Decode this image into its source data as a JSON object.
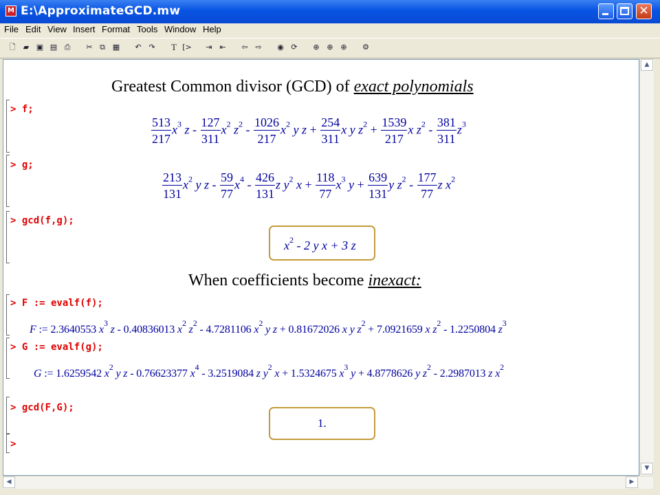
{
  "window": {
    "title": "E:\\ApproximateGCD.mw",
    "icon_name": "maple-icon",
    "buttons": [
      "minimize",
      "maximize",
      "close"
    ]
  },
  "menu": [
    "File",
    "Edit",
    "View",
    "Insert",
    "Format",
    "Tools",
    "Window",
    "Help"
  ],
  "toolbar_icons": [
    "new-icon",
    "open-icon",
    "save-icon",
    "save-all-icon",
    "print-icon",
    "cut-icon",
    "copy-icon",
    "paste-icon",
    "undo-icon",
    "redo-icon",
    "text-icon",
    "prompt-icon",
    "indent-icon",
    "outdent-icon",
    "back-icon",
    "forward-icon",
    "stop-icon",
    "restart-icon",
    "zoom-100-icon",
    "zoom-150-icon",
    "zoom-200-icon",
    "help-icon"
  ],
  "document": {
    "heading1": {
      "prefix": "Greatest Common divisor (GCD) of ",
      "emph": "exact polynomials"
    },
    "cmd_f": "> f;",
    "cmd_g": "> g;",
    "cmd_gcd": "> gcd(f,g);",
    "gcd_result": {
      "t1": "x",
      "e1": "2",
      "rest": " - 2 y x + 3 z"
    },
    "heading2": {
      "prefix": "When coefficients become ",
      "emph": "inexact:"
    },
    "cmd_F": "> F := evalf(f);",
    "cmd_G": "> G := evalf(g);",
    "cmd_gcdF": "> gcd(F,G);",
    "gcdF_result": "1.",
    "final_prompt": ">",
    "f_terms": [
      {
        "n": "513",
        "d": "217",
        "vars": "x^3 z",
        "sign": " - "
      },
      {
        "n": "127",
        "d": "311",
        "vars": "x^2 z^2",
        "sign": " - "
      },
      {
        "n": "1026",
        "d": "217",
        "vars": "x^2 y z",
        "sign": " + "
      },
      {
        "n": "254",
        "d": "311",
        "vars": "x y z^2",
        "sign": " + "
      },
      {
        "n": "1539",
        "d": "217",
        "vars": "x z^2",
        "sign": " - "
      },
      {
        "n": "381",
        "d": "311",
        "vars": "z^3",
        "sign": ""
      }
    ],
    "g_terms": [
      {
        "n": "213",
        "d": "131",
        "vars": "x^2 y z",
        "sign": " - "
      },
      {
        "n": "59",
        "d": "77",
        "vars": "x^4",
        "sign": " - "
      },
      {
        "n": "426",
        "d": "131",
        "vars": "z y^2 x",
        "sign": " + "
      },
      {
        "n": "118",
        "d": "77",
        "vars": "x^3 y",
        "sign": " + "
      },
      {
        "n": "639",
        "d": "131",
        "vars": "y z^2",
        "sign": " - "
      },
      {
        "n": "177",
        "d": "77",
        "vars": "z x^2",
        "sign": ""
      }
    ],
    "F_expr": "F := 2.3640553 x^3 z - 0.40836013 x^2 z^2 - 4.7281106 x^2 y z + 0.81672026 x y z^2 + 7.0921659 x z^2 - 1.2250804 z^3",
    "G_expr": "G := 1.6259542 x^2 y z - 0.76623377 x^4 - 3.2519084 z y^2 x + 1.5324675 x^3 y + 4.8778626 y z^2 - 2.2987013 z x^2"
  },
  "colors": {
    "titlebar": "#0a4ad4",
    "prompt": "#e00000",
    "math": "#00009e",
    "box": "#c49a3a"
  }
}
